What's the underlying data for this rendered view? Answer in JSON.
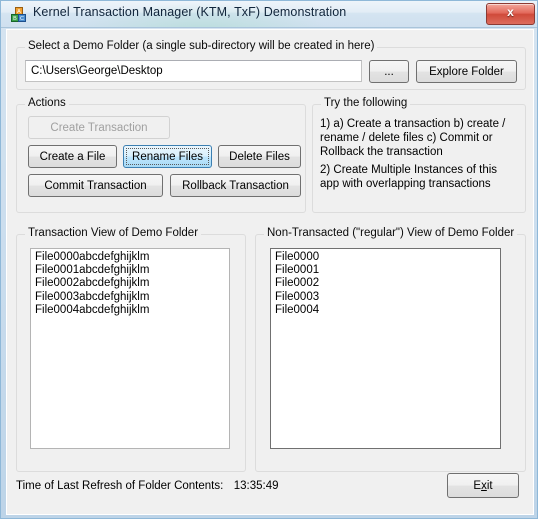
{
  "window": {
    "title": "Kernel Transaction Manager (KTM, TxF) Demonstration",
    "icon": "blocks-icon",
    "close_glyph": "x"
  },
  "folder_group": {
    "legend": "Select a Demo Folder (a single sub-directory will be created in here)",
    "path_value": "C:\\Users\\George\\Desktop",
    "path_placeholder": "",
    "browse_label": "...",
    "explore_label": "Explore Folder"
  },
  "actions_group": {
    "legend": "Actions",
    "buttons": [
      {
        "label": "Create Transaction",
        "state": "disabled"
      },
      {
        "label": "Create a File",
        "state": "normal"
      },
      {
        "label": "Rename Files",
        "state": "focused"
      },
      {
        "label": "Delete Files",
        "state": "normal"
      },
      {
        "label": "Commit Transaction",
        "state": "normal"
      },
      {
        "label": "Rollback Transaction",
        "state": "normal"
      }
    ]
  },
  "hints_group": {
    "legend": "Try the following",
    "line1": "1) a) Create a transaction b) create / rename / delete files c) Commit or Rollback the transaction",
    "line2": "2) Create Multiple Instances of this app with overlapping transactions"
  },
  "transaction_view": {
    "legend": "Transaction View of Demo Folder",
    "items": [
      "File0000abcdefghijklm",
      "File0001abcdefghijklm",
      "File0002abcdefghijklm",
      "File0003abcdefghijklm",
      "File0004abcdefghijklm"
    ]
  },
  "regular_view": {
    "legend": "Non-Transacted (\"regular\") View of Demo Folder",
    "items": [
      "File0000",
      "File0001",
      "File0002",
      "File0003",
      "File0004"
    ]
  },
  "status": {
    "refresh_label": "Time of Last Refresh of Folder Contents:",
    "refresh_time": "13:35:49",
    "exit_label_pre": "E",
    "exit_label_mnemonic": "x",
    "exit_label_post": "it"
  },
  "colors": {
    "dialog_face": "#f0f0f0",
    "titlebar_top": "#eef4fa",
    "titlebar_bottom": "#cfe0ef",
    "window_border": "#8fb8d8",
    "focus_blue": "#3c7fb1",
    "focus_fill": "#bee6fd",
    "close_red": "#cf4a3a",
    "text": "#000000",
    "disabled_text": "#a0a0a0"
  }
}
